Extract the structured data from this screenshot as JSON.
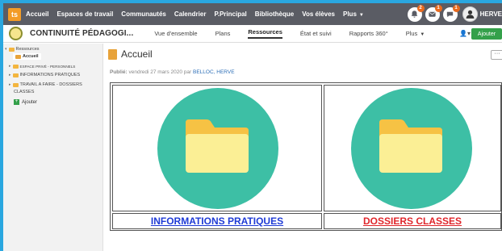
{
  "topnav": {
    "logo": "ts",
    "items": [
      "Accueil",
      "Espaces de travail",
      "Communautés",
      "Calendrier",
      "P.Principal",
      "Bibliothèque",
      "Vos élèves",
      "Plus"
    ],
    "badges": [
      "2",
      "1",
      "1"
    ],
    "user": "HERVE"
  },
  "community": {
    "title": "CONTINUITÉ PÉDAGOGI...",
    "tabs": [
      "Vue d'ensemble",
      "Plans",
      "Ressources",
      "État et suivi",
      "Rapports 360°",
      "Plus"
    ],
    "add_label": "Ajouter"
  },
  "sidebar": {
    "root": "Ressources",
    "selected": "Accueil",
    "items": [
      "ESPACE PRIVÉ - PERSONNELS",
      "INFORMATIONS PRATIQUES",
      "TRAVAIL A FAIRE - DOSSIERS",
      "CLASSES"
    ],
    "add_label": "Ajouter"
  },
  "page": {
    "title": "Accueil",
    "more": "···",
    "published_label": "Publié:",
    "published_date": "vendredi 27 mars 2020 par",
    "author": "BELLOC, HERVE"
  },
  "cards": [
    {
      "label": "INFORMATIONS PRATIQUES",
      "color": "#1f3bd6"
    },
    {
      "label": "DOSSIERS CLASSES",
      "color": "#e0262b"
    }
  ],
  "colors": {
    "accent": "#34a04a",
    "circle": "#3dbfa5",
    "nav": "#5a5c64"
  }
}
